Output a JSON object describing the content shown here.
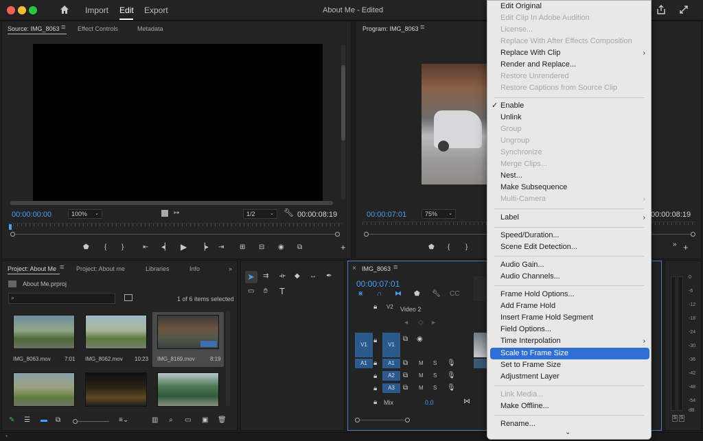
{
  "window": {
    "title": "About Me",
    "subtitle": "Edited",
    "nav": [
      "Import",
      "Edit",
      "Export"
    ]
  },
  "source_panel": {
    "tabs": [
      "Source: IMG_8063",
      "Effect Controls",
      "Metadata"
    ],
    "timecode_in": "00:00:00:00",
    "zoom": "100%",
    "resolution": "1/2",
    "timecode_out": "00:00:08:19"
  },
  "program_panel": {
    "tab": "Program: IMG_8063",
    "timecode_in": "00:00:07:01",
    "zoom": "75%",
    "timecode_out": "00:00:08:19"
  },
  "project_panel": {
    "tabs": [
      "Project: About Me",
      "Project: About me",
      "Libraries",
      "Info"
    ],
    "file": "About Me.prproj",
    "selection_status": "1 of 6 items selected",
    "items": [
      {
        "name": "IMG_8063.mov",
        "duration": "7:01"
      },
      {
        "name": "IMG_8062.mov",
        "duration": "10:23"
      },
      {
        "name": "IMG_8169.mov",
        "duration": "8:19"
      }
    ]
  },
  "timeline": {
    "tab": "IMG_8063",
    "timecode": "00:00:07:01",
    "video2_name": "Video 2",
    "tracks_video": [
      "V2",
      "V1"
    ],
    "tracks_audio": [
      "A1",
      "A2",
      "A3"
    ],
    "source_v1": "V1",
    "source_a1": "A1",
    "mix_label": "Mix",
    "mix_value": "0.0",
    "m_label": "M",
    "s_label": "S"
  },
  "meter": {
    "ticks": [
      "0",
      "-6",
      "-12",
      "-18",
      "-24",
      "-30",
      "-36",
      "-42",
      "-48",
      "-54",
      "dB"
    ],
    "solo_labels": [
      "S",
      "S"
    ]
  },
  "context_menu": {
    "items": [
      {
        "label": "Edit Original",
        "enabled": true
      },
      {
        "label": "Edit Clip In Adobe Audition",
        "enabled": false
      },
      {
        "label": "License...",
        "enabled": false
      },
      {
        "label": "Replace With After Effects Composition",
        "enabled": false
      },
      {
        "label": "Replace With Clip",
        "enabled": true,
        "submenu": true
      },
      {
        "label": "Render and Replace...",
        "enabled": true
      },
      {
        "label": "Restore Unrendered",
        "enabled": false
      },
      {
        "label": "Restore Captions from Source Clip",
        "enabled": false
      },
      {
        "label": "Enable",
        "enabled": true,
        "checked": true
      },
      {
        "label": "Unlink",
        "enabled": true
      },
      {
        "label": "Group",
        "enabled": false
      },
      {
        "label": "Ungroup",
        "enabled": false
      },
      {
        "label": "Synchronize",
        "enabled": false
      },
      {
        "label": "Merge Clips...",
        "enabled": false
      },
      {
        "label": "Nest...",
        "enabled": true
      },
      {
        "label": "Make Subsequence",
        "enabled": true
      },
      {
        "label": "Multi-Camera",
        "enabled": false,
        "submenu": true
      },
      {
        "label": "Label",
        "enabled": true,
        "submenu": true
      },
      {
        "label": "Speed/Duration...",
        "enabled": true
      },
      {
        "label": "Scene Edit Detection...",
        "enabled": true
      },
      {
        "label": "Audio Gain...",
        "enabled": true
      },
      {
        "label": "Audio Channels...",
        "enabled": true
      },
      {
        "label": "Frame Hold Options...",
        "enabled": true
      },
      {
        "label": "Add Frame Hold",
        "enabled": true
      },
      {
        "label": "Insert Frame Hold Segment",
        "enabled": true
      },
      {
        "label": "Field Options...",
        "enabled": true
      },
      {
        "label": "Time Interpolation",
        "enabled": true,
        "submenu": true
      },
      {
        "label": "Scale to Frame Size",
        "enabled": true,
        "highlighted": true
      },
      {
        "label": "Set to Frame Size",
        "enabled": true
      },
      {
        "label": "Adjustment Layer",
        "enabled": true
      },
      {
        "label": "Link Media...",
        "enabled": false
      },
      {
        "label": "Make Offline...",
        "enabled": true
      },
      {
        "label": "Rename...",
        "enabled": true
      }
    ]
  },
  "colors": {
    "accent_blue": "#4a9ff5",
    "highlight": "#2f6fd8",
    "track_blue": "#2b5b8c"
  }
}
